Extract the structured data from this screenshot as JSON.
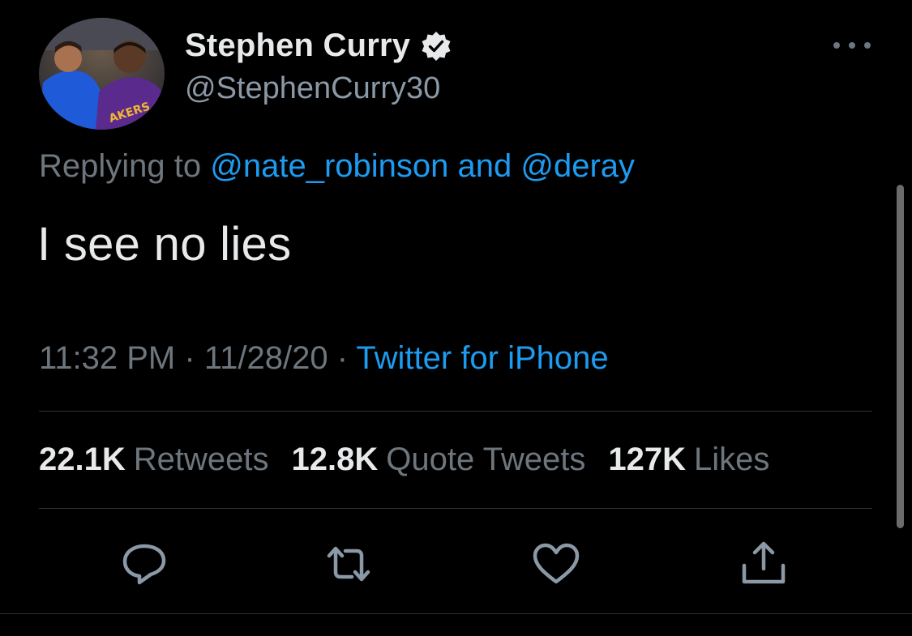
{
  "author": {
    "display_name": "Stephen Curry",
    "handle": "@StephenCurry30",
    "verified": true,
    "avatar_icon": "avatar-photo"
  },
  "reply": {
    "prefix": "Replying to",
    "user1": "@nate_robinson",
    "conjunction": "and",
    "user2": "@deray"
  },
  "tweet": {
    "text": "I see no lies",
    "time": "11:32 PM",
    "separator": "·",
    "date": "11/28/20",
    "source": "Twitter for iPhone"
  },
  "stats": {
    "retweets_count": "22.1K",
    "retweets_label": "Retweets",
    "quotes_count": "12.8K",
    "quotes_label": "Quote Tweets",
    "likes_count": "127K",
    "likes_label": "Likes"
  },
  "actions": {
    "reply_icon": "reply-icon",
    "retweet_icon": "retweet-icon",
    "like_icon": "heart-icon",
    "share_icon": "share-icon"
  },
  "colors": {
    "background": "#000000",
    "accent": "#1d9bf0",
    "secondary_text": "#6e767d",
    "primary_text": "#e7e9ea",
    "divider": "#2f3336"
  }
}
